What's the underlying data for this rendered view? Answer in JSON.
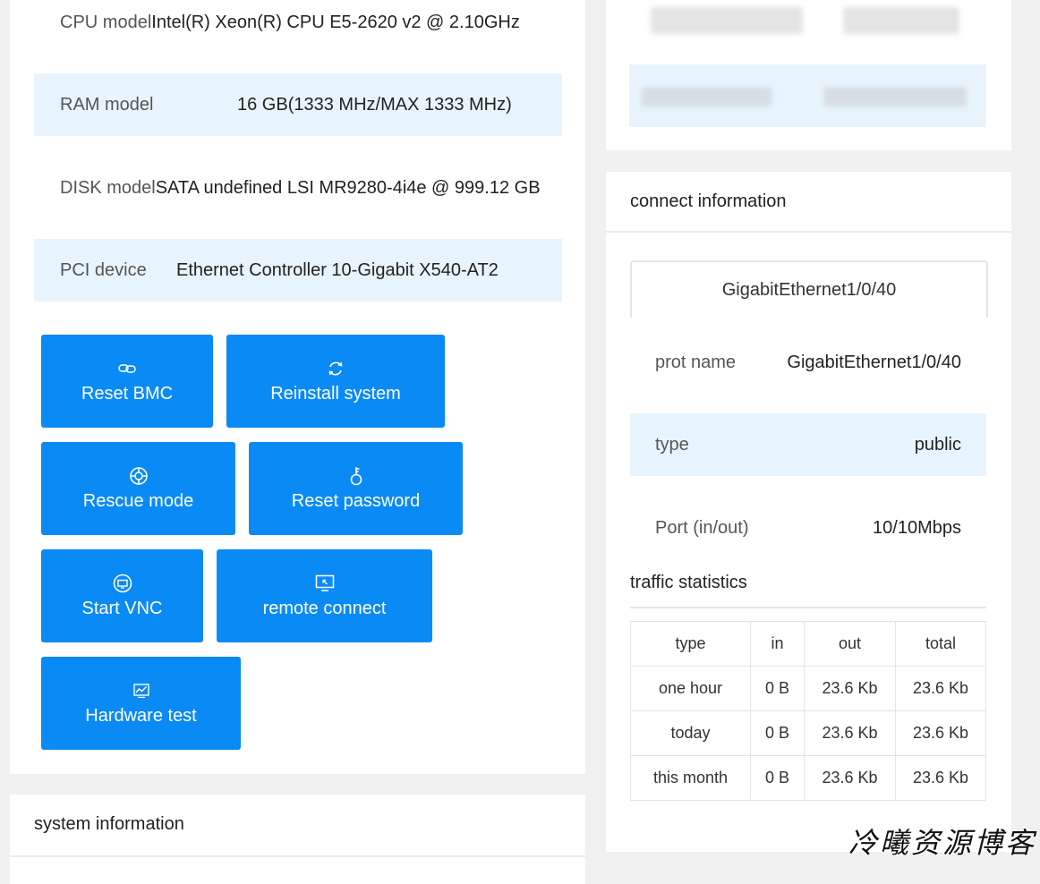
{
  "hardware": {
    "cpu": {
      "label": "CPU model",
      "value": "Intel(R) Xeon(R) CPU E5-2620 v2 @ 2.10GHz"
    },
    "ram": {
      "label": "RAM model",
      "value": "16 GB(1333 MHz/MAX 1333 MHz)"
    },
    "disk": {
      "label": "DISK model",
      "value": "SATA undefined LSI MR9280-4i4e @ 999.12 GB"
    },
    "pci": {
      "label": "PCI device",
      "value": "Ethernet Controller 10-Gigabit X540-AT2"
    }
  },
  "actions": [
    {
      "label": "Reset BMC",
      "icon": "link-icon"
    },
    {
      "label": "Reinstall system",
      "icon": "refresh-icon"
    },
    {
      "label": "Rescue mode",
      "icon": "lifebuoy-icon"
    },
    {
      "label": "Reset password",
      "icon": "key-icon"
    },
    {
      "label": "Start VNC",
      "icon": "vnc-icon"
    },
    {
      "label": "remote connect",
      "icon": "remote-monitor-icon"
    },
    {
      "label": "Hardware test",
      "icon": "chart-monitor-icon"
    }
  ],
  "system_information": {
    "title": "system information"
  },
  "connect_information": {
    "title": "connect information",
    "port_tab": "GigabitEthernet1/0/40",
    "rows": [
      {
        "label": "prot name",
        "value": "GigabitEthernet1/0/40"
      },
      {
        "label": "type",
        "value": "public"
      },
      {
        "label": "Port (in/out)",
        "value": "10/10Mbps"
      }
    ]
  },
  "traffic": {
    "title": "traffic statistics",
    "columns": [
      "type",
      "in",
      "out",
      "total"
    ],
    "rows": [
      [
        "one hour",
        "0 B",
        "23.6 Kb",
        "23.6 Kb"
      ],
      [
        "today",
        "0 B",
        "23.6 Kb",
        "23.6 Kb"
      ],
      [
        "this month",
        "0 B",
        "23.6 Kb",
        "23.6 Kb"
      ]
    ]
  },
  "watermark": "冷曦资源博客",
  "colors": {
    "accent": "#0a8af5",
    "highlight_row": "#e8f4fd",
    "background": "#f0f0f0"
  }
}
